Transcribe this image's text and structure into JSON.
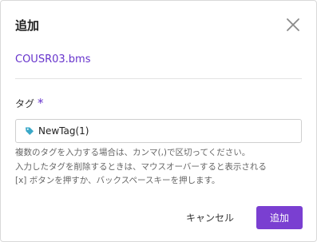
{
  "dialog": {
    "title": "追加",
    "close_icon": "close-icon",
    "filename": "COUSR03.bms",
    "field": {
      "label": "タグ",
      "required_mark": "*",
      "tag": {
        "icon": "tag-icon",
        "text": "NewTag(1)"
      }
    },
    "help_lines": [
      "複数のタグを入力する場合は、カンマ(,)で区切ってください。",
      "入力したタグを削除するときは、マウスオーバーすると表示される",
      "[x] ボタンを押すか、バックスペースキーを押します。"
    ],
    "buttons": {
      "cancel": "キャンセル",
      "add": "追加"
    },
    "colors": {
      "accent": "#7a3fd1",
      "link": "#6633cc",
      "tag_icon": "#3aa8c8"
    }
  }
}
